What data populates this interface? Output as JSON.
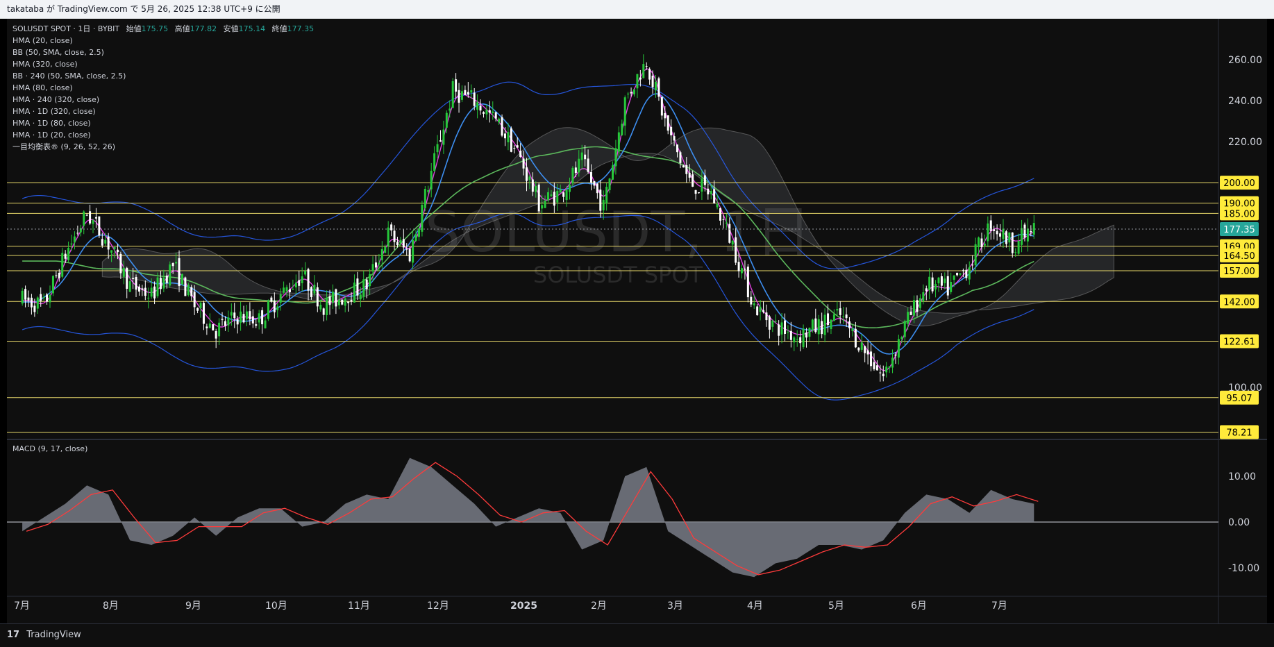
{
  "header": {
    "text": "takataba が TradingView.com で 5月 26, 2025 12:38 UTC+9 に公開"
  },
  "legend": {
    "symbol": "SOLUSDT SPOT · 1日 · BYBIT",
    "open_label": "始値",
    "open": "175.75",
    "high_label": "高値",
    "high": "177.82",
    "low_label": "安値",
    "low": "175.14",
    "close_label": "終値",
    "close": "177.35",
    "indicators": [
      "HMA (20, close)",
      "BB (50, SMA, close, 2.5)",
      "HMA (320, close)",
      "BB · 240 (50, SMA, close, 2.5)",
      "HMA (80, close)",
      "HMA · 240 (320, close)",
      "HMA · 1D (320, close)",
      "HMA · 1D (80, close)",
      "HMA · 1D (20, close)",
      "一目均衡表® (9, 26, 52, 26)"
    ]
  },
  "watermark": {
    "main": "SOLUSDT, 1日",
    "sub": "SOLUSDT SPOT"
  },
  "macd_label": "MACD (9, 17, close)",
  "footer": {
    "logo": "17",
    "brand": "TradingView"
  },
  "colors": {
    "up": "#26c83a",
    "down": "#ffffff",
    "level_line": "#e8d86a",
    "level_tag": "#ffeb3b",
    "price_tag": "#26a69a",
    "hma20": "#e040e0",
    "hma80": "#3d8ef0",
    "hma320": "#5cb85c",
    "bb": "#2962ff",
    "macd_fill": "#787b86",
    "signal": "#ff3b3b"
  },
  "chart_data": {
    "type": "candlestick",
    "symbol": "SOLUSDT SPOT",
    "timeframe": "1日",
    "exchange": "BYBIT",
    "last_price": 177.35,
    "ohlc_last": {
      "open": 175.75,
      "high": 177.82,
      "low": 175.14,
      "close": 177.35
    },
    "y_axis_ticks": [
      100.0,
      220.0,
      240.0,
      260.0
    ],
    "price_levels": [
      200.0,
      190.0,
      185.0,
      169.0,
      164.5,
      157.0,
      142.0,
      122.61,
      95.07,
      78.21
    ],
    "ylim": [
      75,
      280
    ],
    "x_labels": [
      "7月",
      "8月",
      "9月",
      "10月",
      "11月",
      "12月",
      "2025",
      "2月",
      "3月",
      "4月",
      "5月",
      "6月",
      "7月"
    ],
    "weekly_close_approx": [
      {
        "date": "2024-07-01",
        "close": 143
      },
      {
        "date": "2024-07-08",
        "close": 140
      },
      {
        "date": "2024-07-15",
        "close": 165
      },
      {
        "date": "2024-07-22",
        "close": 185
      },
      {
        "date": "2024-07-29",
        "close": 170
      },
      {
        "date": "2024-08-05",
        "close": 150
      },
      {
        "date": "2024-08-12",
        "close": 145
      },
      {
        "date": "2024-08-19",
        "close": 160
      },
      {
        "date": "2024-08-26",
        "close": 140
      },
      {
        "date": "2024-09-02",
        "close": 128
      },
      {
        "date": "2024-09-09",
        "close": 135
      },
      {
        "date": "2024-09-16",
        "close": 133
      },
      {
        "date": "2024-09-23",
        "close": 145
      },
      {
        "date": "2024-09-30",
        "close": 155
      },
      {
        "date": "2024-10-07",
        "close": 140
      },
      {
        "date": "2024-10-14",
        "close": 145
      },
      {
        "date": "2024-10-21",
        "close": 150
      },
      {
        "date": "2024-10-28",
        "close": 175
      },
      {
        "date": "2024-11-04",
        "close": 165
      },
      {
        "date": "2024-11-11",
        "close": 205
      },
      {
        "date": "2024-11-18",
        "close": 245
      },
      {
        "date": "2024-11-25",
        "close": 240
      },
      {
        "date": "2024-12-02",
        "close": 230
      },
      {
        "date": "2024-12-09",
        "close": 215
      },
      {
        "date": "2024-12-16",
        "close": 190
      },
      {
        "date": "2024-12-23",
        "close": 195
      },
      {
        "date": "2024-12-30",
        "close": 210
      },
      {
        "date": "2025-01-06",
        "close": 188
      },
      {
        "date": "2025-01-13",
        "close": 240
      },
      {
        "date": "2025-01-20",
        "close": 260
      },
      {
        "date": "2025-01-27",
        "close": 225
      },
      {
        "date": "2025-02-03",
        "close": 200
      },
      {
        "date": "2025-02-10",
        "close": 195
      },
      {
        "date": "2025-02-17",
        "close": 170
      },
      {
        "date": "2025-02-24",
        "close": 140
      },
      {
        "date": "2025-03-03",
        "close": 130
      },
      {
        "date": "2025-03-10",
        "close": 125
      },
      {
        "date": "2025-03-17",
        "close": 130
      },
      {
        "date": "2025-03-24",
        "close": 135
      },
      {
        "date": "2025-03-31",
        "close": 120
      },
      {
        "date": "2025-04-07",
        "close": 105
      },
      {
        "date": "2025-04-14",
        "close": 130
      },
      {
        "date": "2025-04-21",
        "close": 150
      },
      {
        "date": "2025-04-28",
        "close": 148
      },
      {
        "date": "2025-05-05",
        "close": 160
      },
      {
        "date": "2025-05-12",
        "close": 180
      },
      {
        "date": "2025-05-19",
        "close": 170
      },
      {
        "date": "2025-05-26",
        "close": 177.35
      }
    ],
    "macd": {
      "y_axis_ticks": [
        10.0,
        0.0,
        -10.0
      ],
      "hist_approx": [
        -2,
        1,
        4,
        8,
        6,
        -4,
        -5,
        -3,
        1,
        -3,
        1,
        3,
        3,
        -1,
        0,
        4,
        6,
        5,
        14,
        12,
        8,
        4,
        -1,
        1,
        3,
        2,
        -6,
        -4,
        10,
        12,
        -2,
        -5,
        -8,
        -11,
        -12,
        -9,
        -8,
        -5,
        -5,
        -6,
        -4,
        2,
        6,
        5,
        2,
        7,
        5,
        4
      ]
    }
  }
}
